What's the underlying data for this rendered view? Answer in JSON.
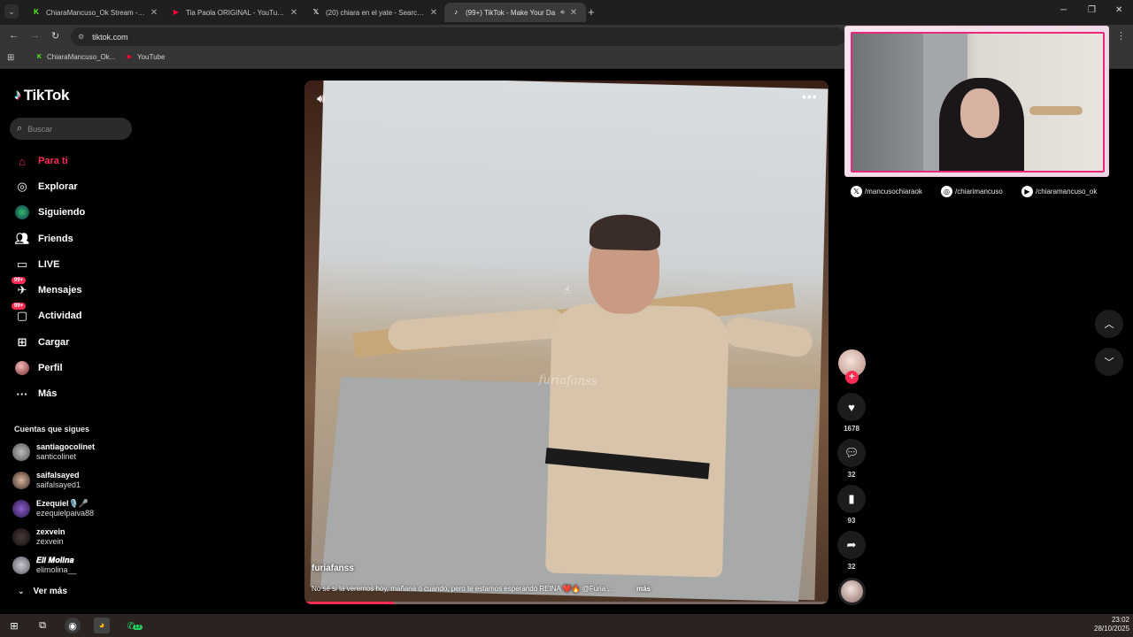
{
  "browser": {
    "tabs": [
      {
        "title": "ChiaraMancuso_Ok Stream - W",
        "favicon": "kick-icon",
        "color": "#53fc18",
        "active": false
      },
      {
        "title": "Tia Paola ORIGINAL - YouTube",
        "favicon": "youtube-icon",
        "color": "#ff0033",
        "active": false
      },
      {
        "title": "(20) chiara en el yate - Search /",
        "favicon": "x-icon",
        "color": "#ffffff",
        "active": false
      },
      {
        "title": "(99+) TikTok - Make Your Da",
        "favicon": "tiktok-icon",
        "color": "#ffffff",
        "active": true
      }
    ],
    "url": "tiktok.com",
    "bookmarks": [
      {
        "label": "ChiaraMancuso_Ok...",
        "favicon": "kick-icon",
        "color": "#53fc18"
      },
      {
        "label": "YouTube",
        "favicon": "youtube-icon",
        "color": "#ff0033"
      }
    ]
  },
  "tiktok": {
    "brand": "TikTok",
    "search_placeholder": "Buscar",
    "nav": [
      {
        "label": "Para ti",
        "icon": "home-icon",
        "active": true
      },
      {
        "label": "Explorar",
        "icon": "compass-icon"
      },
      {
        "label": "Siguiendo",
        "icon": "following-icon"
      },
      {
        "label": "Friends",
        "icon": "friends-icon"
      },
      {
        "label": "LIVE",
        "icon": "live-icon"
      },
      {
        "label": "Mensajes",
        "icon": "messages-icon",
        "badge": "99+"
      },
      {
        "label": "Actividad",
        "icon": "activity-icon",
        "badge": "99+"
      },
      {
        "label": "Cargar",
        "icon": "upload-icon"
      },
      {
        "label": "Perfil",
        "icon": "profile-icon"
      },
      {
        "label": "Más",
        "icon": "more-icon"
      }
    ],
    "following_heading": "Cuentas que sigues",
    "following": [
      {
        "name": "santiagocolinet",
        "handle": "santicolinet"
      },
      {
        "name": "saifalsayed",
        "handle": "saifalsayed1"
      },
      {
        "name": "Ezequiel🎙️🎤",
        "handle": "ezequielpaiva88"
      },
      {
        "name": "zexvein",
        "handle": "zexvein"
      },
      {
        "name": "𝑬𝒍𝒊 𝑴𝒐𝒍𝒊𝒏𝒂",
        "handle": "elimolina__"
      }
    ],
    "see_more": "Ver más",
    "video": {
      "author": "furiafanss",
      "watermark": "furiafanss",
      "caption": "No sé si la veremos hoy, mañana o cuando, pero te estamos esperando REINA ❤️🔥 @Furia ...",
      "more": "más",
      "progress": 0.17
    },
    "actions": {
      "likes": "1678",
      "comments": "32",
      "saves": "93",
      "shares": "32"
    }
  },
  "overlay": {
    "socials": [
      {
        "icon": "x-icon",
        "handle": "/mancusochiaraok"
      },
      {
        "icon": "instagram-icon",
        "handle": "/chiarimancuso"
      },
      {
        "icon": "youtube-icon",
        "handle": "/chiaramancuso_ok"
      }
    ]
  },
  "taskbar": {
    "time": "23:02",
    "date": "28/10/2025",
    "whatsapp_badge": "13"
  }
}
